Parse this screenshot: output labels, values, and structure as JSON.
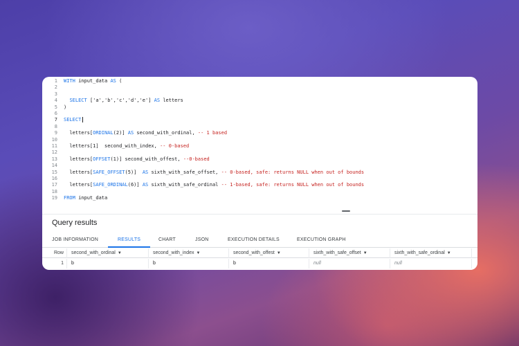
{
  "editor": {
    "lines": [
      {
        "num": "1",
        "segments": [
          {
            "t": "kw",
            "v": "WITH"
          },
          {
            "t": "tx",
            "v": " input_data "
          },
          {
            "t": "kw",
            "v": "AS"
          },
          {
            "t": "tx",
            "v": " ("
          }
        ]
      },
      {
        "num": "2",
        "segments": []
      },
      {
        "num": "3",
        "segments": []
      },
      {
        "num": "4",
        "segments": [
          {
            "t": "tx",
            "v": "  "
          },
          {
            "t": "kw",
            "v": "SELECT"
          },
          {
            "t": "tx",
            "v": " ['a','b','c','d','e'] "
          },
          {
            "t": "kw",
            "v": "AS"
          },
          {
            "t": "tx",
            "v": " letters"
          }
        ]
      },
      {
        "num": "5",
        "segments": [
          {
            "t": "tx",
            "v": ")"
          }
        ]
      },
      {
        "num": "6",
        "segments": []
      },
      {
        "num": "7",
        "segments": [
          {
            "t": "kw",
            "v": "SELECT"
          }
        ],
        "active": true
      },
      {
        "num": "8",
        "segments": []
      },
      {
        "num": "9",
        "segments": [
          {
            "t": "tx",
            "v": "  letters["
          },
          {
            "t": "kw",
            "v": "ORDINAL"
          },
          {
            "t": "tx",
            "v": "(2)] "
          },
          {
            "t": "kw",
            "v": "AS"
          },
          {
            "t": "tx",
            "v": " second_with_ordinal, "
          },
          {
            "t": "cm",
            "v": "-- 1 based"
          }
        ]
      },
      {
        "num": "10",
        "segments": []
      },
      {
        "num": "11",
        "segments": [
          {
            "t": "tx",
            "v": "  letters[1]  second_with_index, "
          },
          {
            "t": "cm",
            "v": "-- 0-based"
          }
        ]
      },
      {
        "num": "12",
        "segments": []
      },
      {
        "num": "13",
        "segments": [
          {
            "t": "tx",
            "v": "  letters["
          },
          {
            "t": "kw",
            "v": "OFFSET"
          },
          {
            "t": "tx",
            "v": "(1)] second_with_offest, "
          },
          {
            "t": "cm",
            "v": "--0-based"
          }
        ]
      },
      {
        "num": "14",
        "segments": []
      },
      {
        "num": "15",
        "segments": [
          {
            "t": "tx",
            "v": "  letters["
          },
          {
            "t": "kw",
            "v": "SAFE_OFFSET"
          },
          {
            "t": "tx",
            "v": "(5)]  "
          },
          {
            "t": "kw",
            "v": "AS"
          },
          {
            "t": "tx",
            "v": " sixth_with_safe_offset, "
          },
          {
            "t": "cm",
            "v": "-- 0-based, safe: returns NULL when out of bounds"
          }
        ]
      },
      {
        "num": "16",
        "segments": []
      },
      {
        "num": "17",
        "segments": [
          {
            "t": "tx",
            "v": "  letters["
          },
          {
            "t": "kw",
            "v": "SAFE_ORDINAL"
          },
          {
            "t": "tx",
            "v": "(6)] "
          },
          {
            "t": "kw",
            "v": "AS"
          },
          {
            "t": "tx",
            "v": " sixth_with_safe_ordinal "
          },
          {
            "t": "cm",
            "v": "-- 1-based, safe: returns NULL when out of bounds"
          }
        ]
      },
      {
        "num": "18",
        "segments": []
      },
      {
        "num": "19",
        "segments": [
          {
            "t": "kw",
            "v": "FROM"
          },
          {
            "t": "tx",
            "v": " input_data"
          }
        ]
      }
    ]
  },
  "results": {
    "title": "Query results",
    "tabs": [
      {
        "label": "JOB INFORMATION",
        "active": false
      },
      {
        "label": "RESULTS",
        "active": true
      },
      {
        "label": "CHART",
        "active": false
      },
      {
        "label": "JSON",
        "active": false
      },
      {
        "label": "EXECUTION DETAILS",
        "active": false
      },
      {
        "label": "EXECUTION GRAPH",
        "active": false
      }
    ],
    "row_header": "Row",
    "columns": [
      "second_with_ordinal",
      "second_with_index",
      "second_with_offest",
      "sixth_with_safe_offset",
      "sixth_with_safe_ordinal"
    ],
    "rows": [
      {
        "row": "1",
        "cells": [
          {
            "v": "b",
            "null": false
          },
          {
            "v": "b",
            "null": false
          },
          {
            "v": "b",
            "null": false
          },
          {
            "v": "null",
            "null": true
          },
          {
            "v": "null",
            "null": true
          }
        ]
      }
    ]
  }
}
